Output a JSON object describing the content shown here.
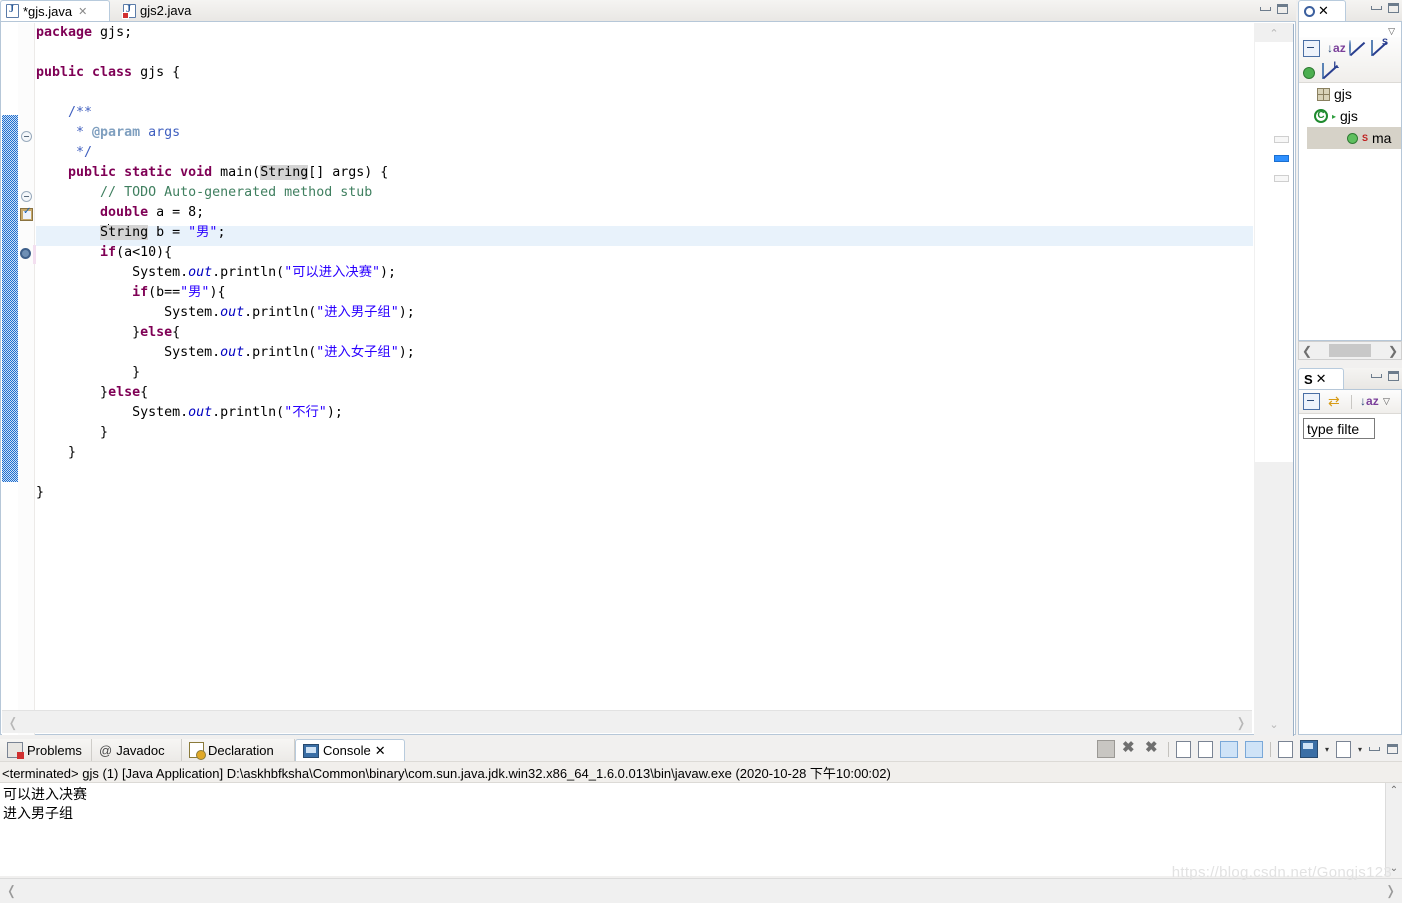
{
  "editor": {
    "tabs": [
      {
        "label": "*gjs.java",
        "active": true,
        "dirty": true,
        "close": "✕",
        "icon": "java-file-icon"
      },
      {
        "label": "gjs2.java",
        "active": false,
        "dirty": false,
        "icon": "java-file-error-icon"
      }
    ],
    "code_lines": [
      "package gjs;",
      "",
      "public class gjs {",
      "",
      "    /**",
      "     * @param args",
      "     */",
      "    public static void main(String[] args) {",
      "        // TODO Auto-generated method stub",
      "        double a = 8;",
      "        String b = \"男\";",
      "        if(a<10){",
      "            System.out.println(\"可以进入决赛\");",
      "            if(b==\"男\"){",
      "                System.out.println(\"进入男子组\");",
      "            }else{",
      "                System.out.println(\"进入女子组\");",
      "            }",
      "        }else{",
      "            System.out.println(\"不行\");",
      "        }",
      "    }",
      "",
      "}"
    ],
    "caret_line": "String b = \"男\";",
    "scroll_left_arrow": "❬",
    "scroll_right_arrow": "❭",
    "scroll_up_arrow": "⌃",
    "scroll_down_arrow": "⌄"
  },
  "outline": {
    "tab_label": "O",
    "tab_close": "✕",
    "menu_arrow": "▽",
    "toolbar": [
      {
        "name": "collapse-all-icon",
        "title": "Collapse All"
      },
      {
        "name": "sort-icon",
        "title": "Sort"
      },
      {
        "name": "hide-fields-icon",
        "title": "Hide Fields"
      },
      {
        "name": "hide-static-icon",
        "title": "Hide Static Members"
      },
      {
        "name": "hide-nonpublic-icon",
        "title": "Hide Non-Public Members"
      },
      {
        "name": "hide-local-icon",
        "title": "Hide Local Types"
      }
    ],
    "sort_letters": {
      "a": "a",
      "z": "z",
      "arrow": "↓"
    },
    "static_sup": "S",
    "local_sup": "L",
    "tree": [
      {
        "label": "gjs",
        "icon": "package-icon",
        "indent": 0,
        "selected": false
      },
      {
        "label": "gjs",
        "icon": "class-icon",
        "indent": 0,
        "selected": false,
        "expander": "▸",
        "glyph": "C"
      },
      {
        "label": "ma",
        "icon": "method-icon",
        "indent": 1,
        "selected": true,
        "badge": "S"
      }
    ],
    "hscroll": {
      "left": "❮",
      "right": "❯"
    }
  },
  "tasks": {
    "tab_label": "S",
    "tab_close": "✕",
    "menu_arrow": "▽",
    "filter_value": "type filte",
    "toolbar": [
      {
        "name": "collapse-all-icon",
        "title": "Collapse All"
      },
      {
        "name": "link-with-editor-icon",
        "title": "Link with Editor"
      },
      {
        "name": "sort-icon",
        "title": "Sort"
      }
    ],
    "sort_letters": {
      "a": "a",
      "z": "z",
      "arrow": "↓"
    }
  },
  "console": {
    "tabs": [
      {
        "label": "Problems",
        "icon": "problems-icon",
        "active": false
      },
      {
        "label": "Javadoc",
        "icon": "javadoc-icon",
        "active": false,
        "glyph": "@"
      },
      {
        "label": "Declaration",
        "icon": "declaration-icon",
        "active": false
      },
      {
        "label": "Console",
        "icon": "console-icon",
        "active": true,
        "close": "✕"
      }
    ],
    "toolbar": [
      {
        "name": "terminate-button",
        "title": "Terminate"
      },
      {
        "name": "remove-launch-button",
        "title": "Remove Launch"
      },
      {
        "name": "remove-all-terminated-button",
        "title": "Remove All Terminated Launches"
      },
      {
        "name": "clear-console-button",
        "title": "Clear Console"
      },
      {
        "name": "scroll-lock-button",
        "title": "Scroll Lock"
      },
      {
        "name": "show-console-on-output-button",
        "title": "Show Console When Standard Out Changes"
      },
      {
        "name": "show-console-on-error-button",
        "title": "Show Console When Standard Error Changes"
      },
      {
        "name": "pin-console-button",
        "title": "Pin Console"
      },
      {
        "name": "display-selected-console-button",
        "title": "Display Selected Console"
      },
      {
        "name": "open-console-button",
        "title": "Open Console"
      }
    ],
    "dropdown_arrow": "▾",
    "header_line": "<terminated> gjs (1) [Java Application] D:\\askhbfksha\\Common\\binary\\com.sun.java.jdk.win32.x86_64_1.6.0.013\\bin\\javaw.exe (2020-10-28 下午10:00:02)",
    "output_lines": [
      "可以进入决赛",
      "进入男子组"
    ],
    "scroll_up": "⌃",
    "scroll_down": "⌄",
    "scroll_left": "❬",
    "scroll_right": "❭"
  },
  "watermark": "https://blog.csdn.net/Gongjs123",
  "colors": {
    "keyword": "#7f0055",
    "string": "#2a00ff",
    "comment": "#3f7f5f",
    "javadoc": "#3f5fbf",
    "field": "#0000c0",
    "highlight_line": "#e8f2fb",
    "selection": "#d4d4d4",
    "tab_border": "#b8cbdd"
  }
}
